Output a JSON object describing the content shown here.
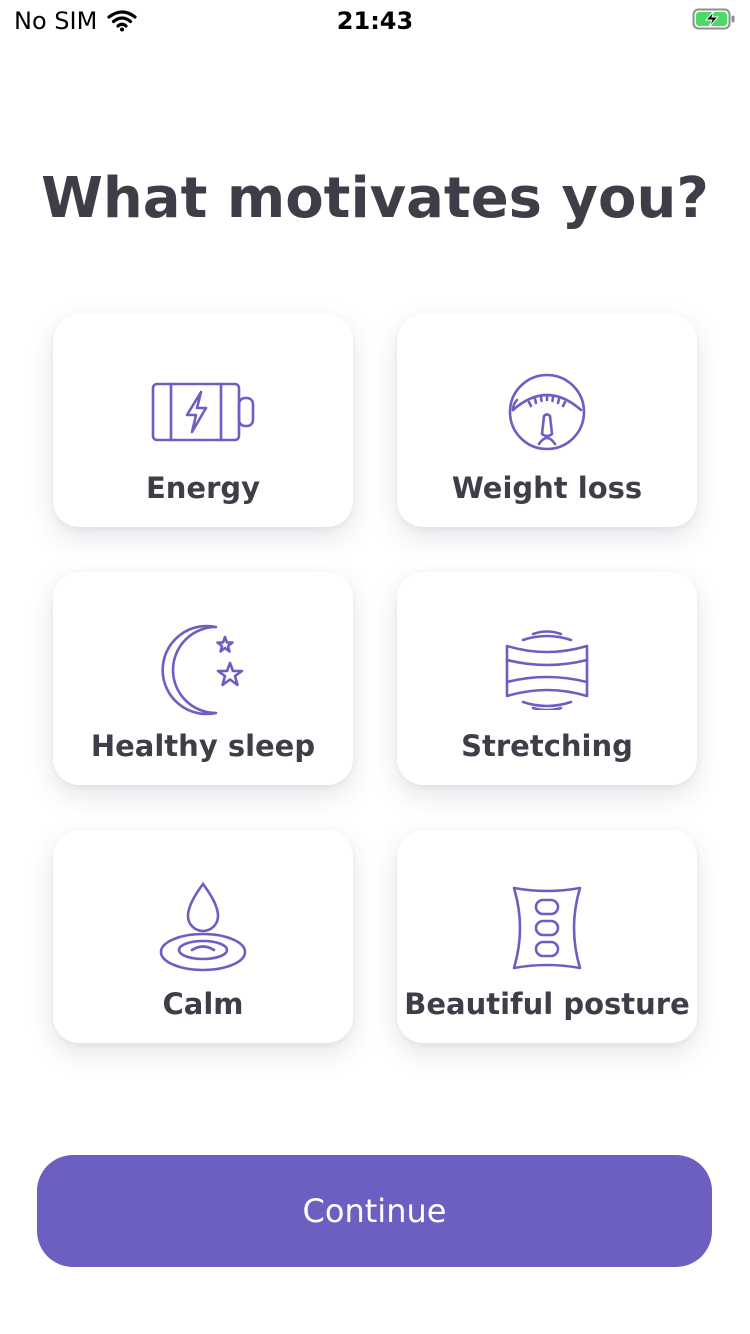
{
  "status_bar": {
    "carrier": "No SIM",
    "time": "21:43",
    "wifi_icon": "wifi-icon",
    "battery_icon": "battery-charging-icon"
  },
  "title": "What motivates you?",
  "options": [
    {
      "label": "Energy",
      "icon": "battery-bolt-icon"
    },
    {
      "label": "Weight loss",
      "icon": "scale-icon"
    },
    {
      "label": "Healthy sleep",
      "icon": "moon-stars-icon"
    },
    {
      "label": "Stretching",
      "icon": "stretch-icon"
    },
    {
      "label": "Calm",
      "icon": "water-drop-icon"
    },
    {
      "label": "Beautiful posture",
      "icon": "spine-icon"
    }
  ],
  "continue_label": "Continue",
  "colors": {
    "accent": "#6b5fc2",
    "icon_stroke": "#6b5fc2",
    "text": "#3f3e48"
  }
}
